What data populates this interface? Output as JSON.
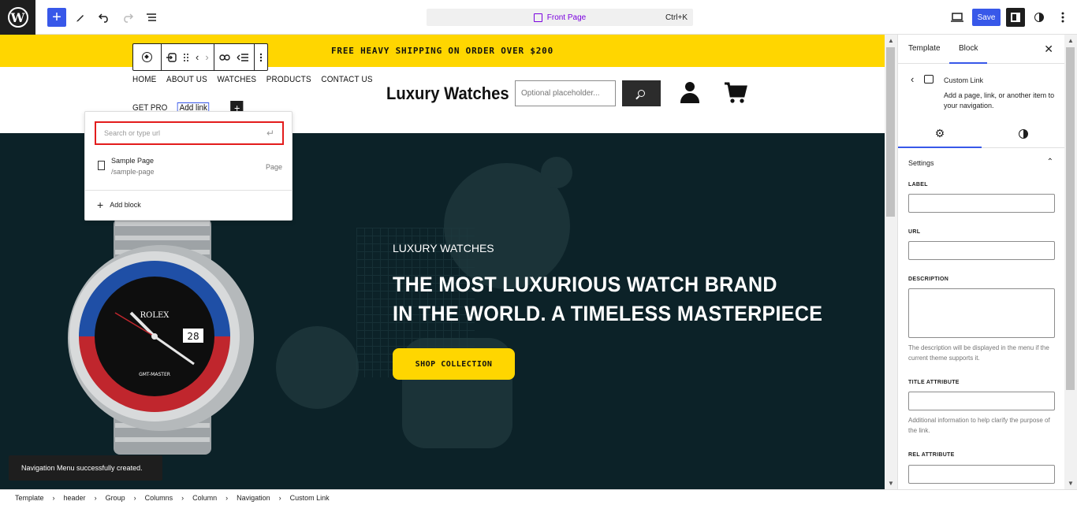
{
  "topbar": {
    "command_title": "Front Page",
    "command_shortcut": "Ctrl+K",
    "save_label": "Save"
  },
  "canvas": {
    "promo_text": "FREE HEAVY SHIPPING ON ORDER OVER $200",
    "nav_items": [
      "HOME",
      "ABOUT US",
      "WATCHES",
      "PRODUCTS",
      "CONTACT US"
    ],
    "nav_items_row2": [
      "GET PRO",
      "Add link"
    ],
    "site_title": "Luxury Watches",
    "search_placeholder": "Optional placeholder...",
    "hero_kicker": "LUXURY WATCHES",
    "hero_title_line1": "THE MOST LUXURIOUS WATCH BRAND",
    "hero_title_line2": "IN THE WORLD. A TIMELESS MASTERPIECE",
    "hero_button": "SHOP COLLECTION",
    "watch_brand": "ROLEX",
    "watch_model": "GMT-MASTER",
    "watch_date": "28"
  },
  "link_popover": {
    "search_placeholder": "Search or type url",
    "suggestion_title": "Sample Page",
    "suggestion_url": "/sample-page",
    "suggestion_type": "Page",
    "add_block_label": "Add block"
  },
  "snackbar": {
    "message": "Navigation Menu successfully created."
  },
  "sidebar": {
    "tab_template": "Template",
    "tab_block": "Block",
    "block_title": "Custom Link",
    "block_description": "Add a page, link, or another item to your navigation.",
    "section_title": "Settings",
    "label_label": "LABEL",
    "url_label": "URL",
    "description_label": "DESCRIPTION",
    "description_help": "The description will be displayed in the menu if the current theme supports it.",
    "title_attr_label": "TITLE ATTRIBUTE",
    "title_attr_help": "Additional information to help clarify the purpose of the link.",
    "rel_attr_label": "REL ATTRIBUTE"
  },
  "breadcrumbs": [
    "Template",
    "header",
    "Group",
    "Columns",
    "Column",
    "Navigation",
    "Custom Link"
  ],
  "colors": {
    "accent": "#3858e9",
    "promo_yellow": "#ffd600",
    "hero_bg": "#0c2228",
    "command_purple": "#7a00df",
    "highlight_red": "#e31c1c"
  }
}
